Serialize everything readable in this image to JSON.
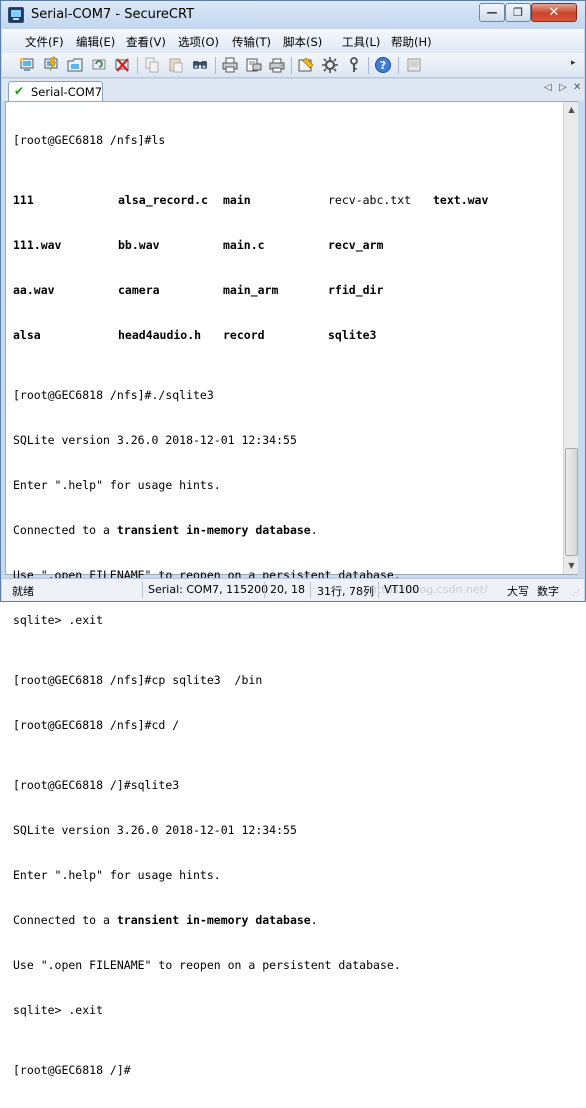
{
  "window": {
    "title": "Serial-COM7 - SecureCRT",
    "min_glyph": "—",
    "max_glyph": "❐",
    "close_glyph": "✕"
  },
  "menu": {
    "items": [
      "文件(F)",
      "编辑(E)",
      "查看(V)",
      "选项(O)",
      "传输(T)",
      "脚本(S)",
      "工具(L)",
      "帮助(H)"
    ]
  },
  "toolbar": {
    "icons": [
      "connect-icon",
      "quick-connect-icon",
      "connect-tab-icon",
      "reconnect-icon",
      "disconnect-icon",
      "copy-icon",
      "paste-icon",
      "find-icon",
      "print-icon",
      "print-setup-icon",
      "print-screen-icon",
      "session-options-icon",
      "global-options-icon",
      "keymap-icon",
      "help-icon",
      "sftp-icon"
    ]
  },
  "tabs": [
    {
      "label": "Serial-COM7",
      "status": "connected"
    }
  ],
  "tab_nav": {
    "prev": "◁",
    "next": "▷",
    "close": "✕"
  },
  "terminal": {
    "prompt_ls": "[root@GEC6818 /nfs]#ls",
    "ls_rows": [
      [
        "111",
        "alsa_record.c",
        "main",
        "recv-abc.txt",
        "text.wav"
      ],
      [
        "111.wav",
        "bb.wav",
        "main.c",
        "recv_arm",
        ""
      ],
      [
        "aa.wav",
        "camera",
        "main_arm",
        "rfid_dir",
        ""
      ],
      [
        "alsa",
        "head4audio.h",
        "record",
        "sqlite3",
        ""
      ]
    ],
    "ls_bold": [
      [
        true,
        true,
        true,
        false,
        true
      ],
      [
        true,
        true,
        true,
        true,
        false
      ],
      [
        true,
        true,
        true,
        true,
        false
      ],
      [
        true,
        true,
        true,
        true,
        false
      ]
    ],
    "session1": {
      "cmd": "[root@GEC6818 /nfs]#./sqlite3",
      "version": "SQLite version 3.26.0 2018-12-01 12:34:55",
      "help": "Enter \".help\" for usage hints.",
      "connected_pre": "Connected to a ",
      "connected_bold": "transient in-memory database",
      "connected_post": ".",
      "use": "Use \".open FILENAME\" to reopen on a persistent database.",
      "exit": "sqlite> .exit"
    },
    "cp_cmd": "[root@GEC6818 /nfs]#cp sqlite3  /bin",
    "cd_cmd": "[root@GEC6818 /nfs]#cd /",
    "session2": {
      "cmd": "[root@GEC6818 /]#sqlite3",
      "version": "SQLite version 3.26.0 2018-12-01 12:34:55",
      "help": "Enter \".help\" for usage hints.",
      "connected_pre": "Connected to a ",
      "connected_bold": "transient in-memory database",
      "connected_post": ".",
      "use": "Use \".open FILENAME\" to reopen on a persistent database.",
      "exit": "sqlite> .exit"
    },
    "final_prompt": "[root@GEC6818 /]#"
  },
  "scrollbar": {
    "up": "▲",
    "down": "▼"
  },
  "status": {
    "state": "就绪",
    "connection": "Serial: COM7, 115200",
    "cursor": "20,  18",
    "size": "31行, 78列",
    "terminal": "VT100",
    "caps": "大写",
    "num": "数字",
    "watermark": "https://blog.csdn.net/",
    "grip": "⋰"
  },
  "colors": {
    "accent": "#5a7ea7",
    "check": "#1c9b1c"
  }
}
